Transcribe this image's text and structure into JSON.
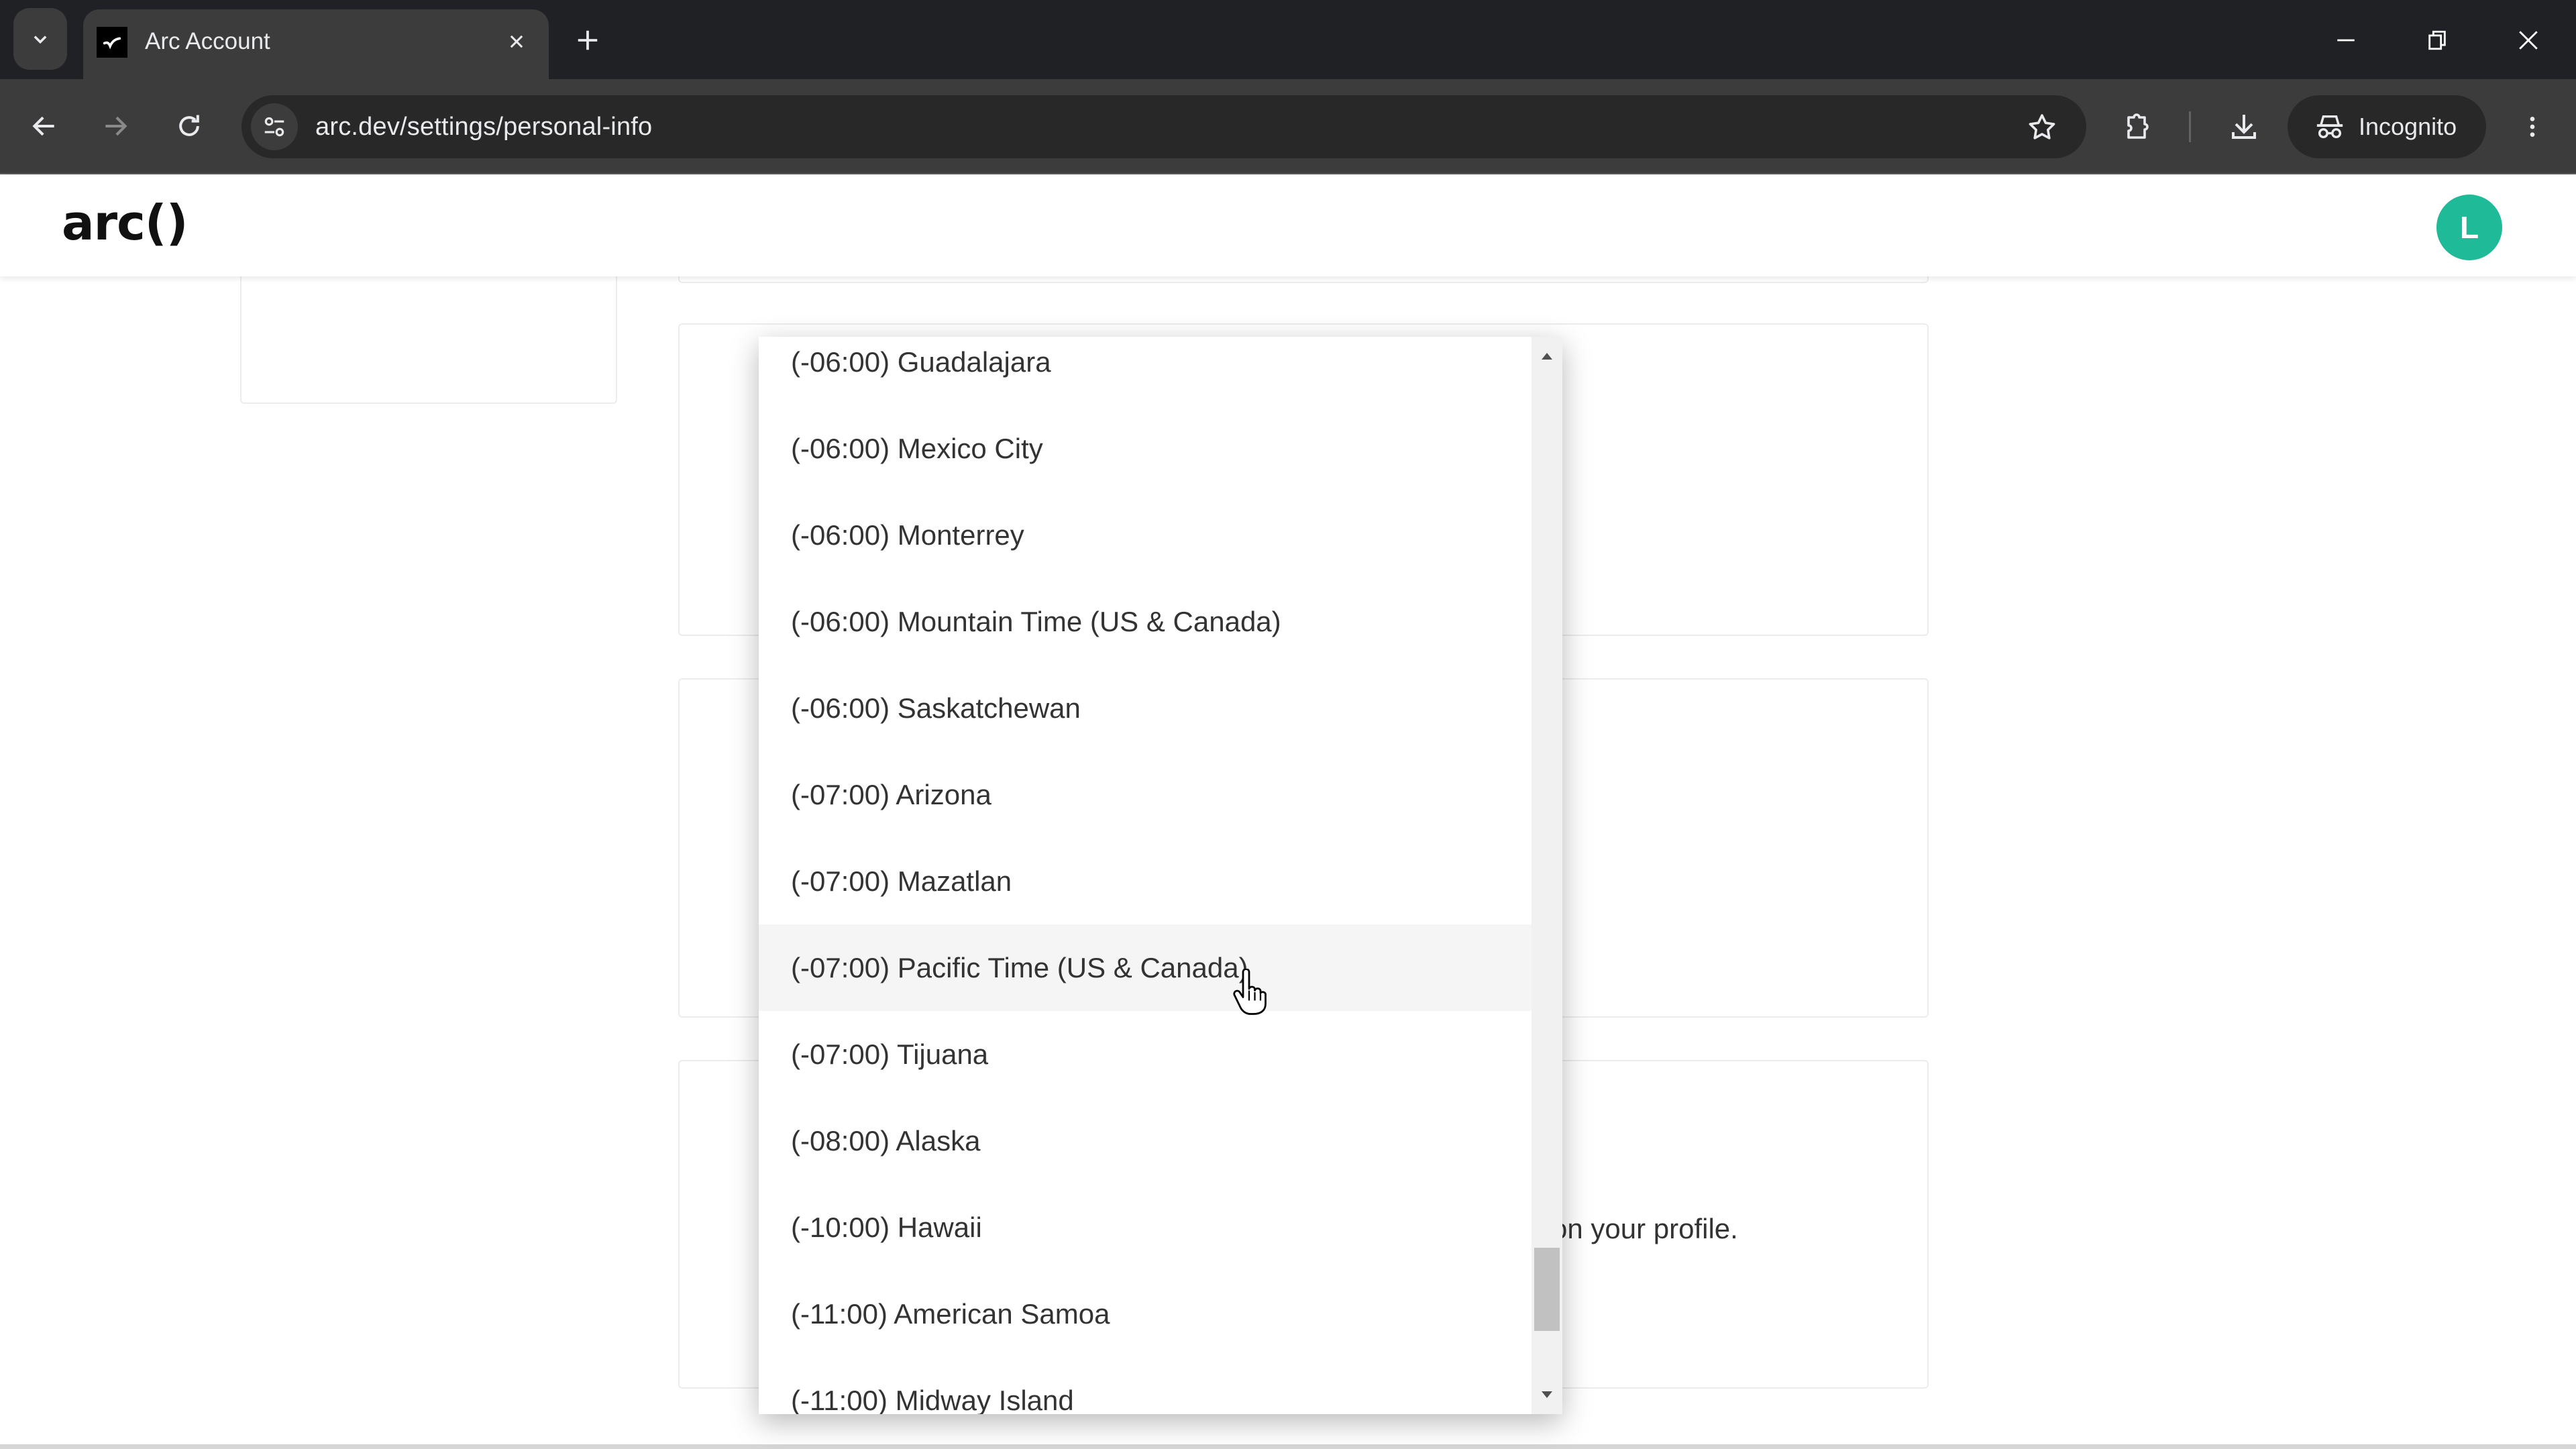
{
  "browser": {
    "tab_title": "Arc Account",
    "url": "arc.dev/settings/personal-info",
    "profile_label": "Incognito",
    "icons": {
      "tab_search": "chevron-down-icon",
      "favicon": "arc-favicon",
      "tab_close": "close-icon",
      "new_tab": "plus-icon",
      "minimize": "minimize-icon",
      "restore": "restore-icon",
      "window_close": "close-icon",
      "back": "arrow-left-icon",
      "forward": "arrow-right-icon",
      "reload": "reload-icon",
      "site_info": "tune-icon",
      "bookmark": "star-icon",
      "extensions": "puzzle-icon",
      "downloads": "download-icon",
      "incognito": "incognito-icon",
      "menu": "kebab-menu-icon"
    }
  },
  "header": {
    "logo": "arc()",
    "avatar_initial": "L",
    "avatar_color": "#1fbb99"
  },
  "main": {
    "visible_card_text": "on your profile."
  },
  "timezone_dropdown": {
    "options": [
      "(-06:00) Guadalajara",
      "(-06:00) Mexico City",
      "(-06:00) Monterrey",
      "(-06:00) Mountain Time (US & Canada)",
      "(-06:00) Saskatchewan",
      "(-07:00) Arizona",
      "(-07:00) Mazatlan",
      "(-07:00) Pacific Time (US & Canada)",
      "(-07:00) Tijuana",
      "(-08:00) Alaska",
      "(-10:00) Hawaii",
      "(-11:00) American Samoa",
      "(-11:00) Midway Island"
    ],
    "hovered_option": "(-07:00) Pacific Time (US & Canada)",
    "scroll_position_percent": 95
  }
}
